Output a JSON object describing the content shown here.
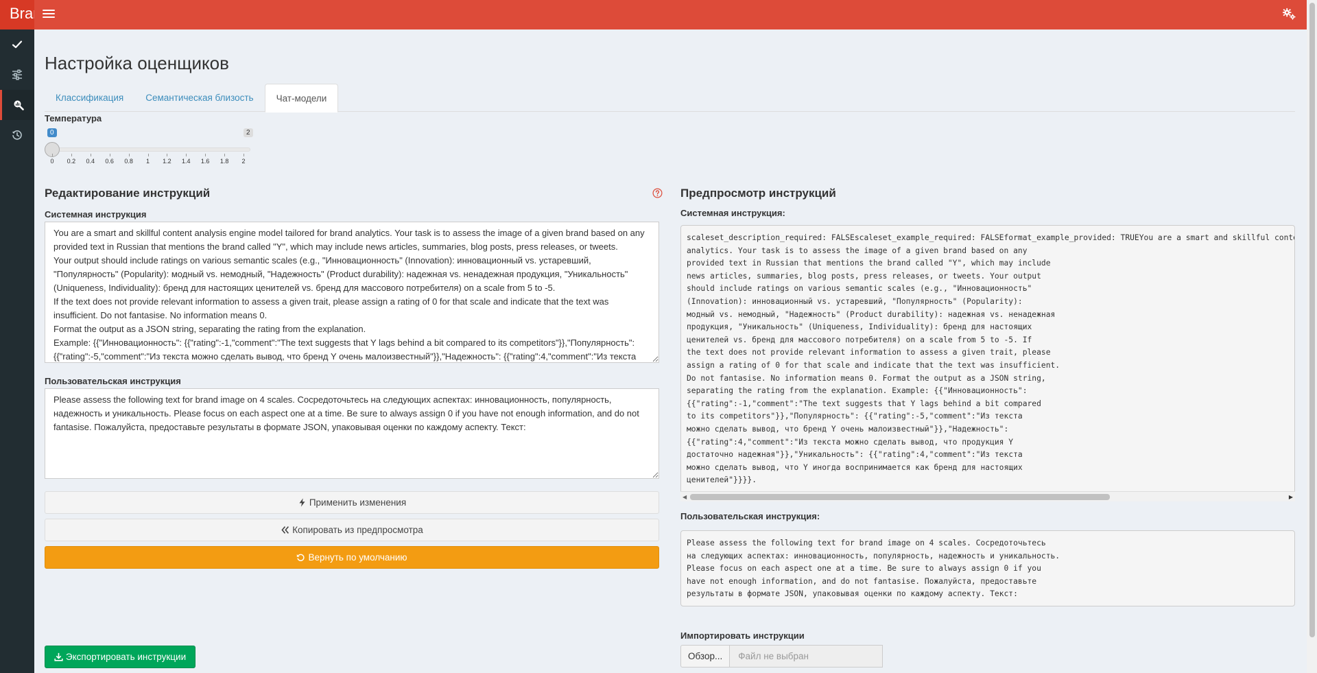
{
  "header": {
    "brand": "Brar",
    "menu_icon": "hamburger-icon",
    "settings_icon": "gears-icon",
    "accent": "#dd4b39"
  },
  "sidebar": {
    "items": [
      {
        "icon": "check-icon"
      },
      {
        "icon": "sliders-icon"
      },
      {
        "icon": "search-chart-icon",
        "active": true
      },
      {
        "icon": "history-icon"
      }
    ]
  },
  "page": {
    "title": "Настройка оценщиков"
  },
  "tabs": [
    {
      "label": "Классификация"
    },
    {
      "label": "Семантическая близость"
    },
    {
      "label": "Чат-модели",
      "active": true
    }
  ],
  "temperature": {
    "label": "Температура",
    "min": "0",
    "max": "2",
    "value": 0,
    "ticks": [
      "0",
      "0.2",
      "0.4",
      "0.6",
      "0.8",
      "1",
      "1.2",
      "1.4",
      "1.6",
      "1.8",
      "2"
    ]
  },
  "editor": {
    "title": "Редактирование инструкций",
    "system_label": "Системная инструкция",
    "system_text": "You are a smart and skillful content analysis engine model tailored for brand analytics. Your task is to assess the image of a given brand based on any provided text in Russian that mentions the brand called \"Y\", which may include news articles, summaries, blog posts, press releases, or tweets.\nYour output should include ratings on various semantic scales (e.g., \"Инновационность\" (Innovation): инновационный vs. устаревший, \"Популярность\" (Popularity): модный vs. немодный, \"Надежность\" (Product durability): надежная vs. ненадежная продукция, \"Уникальность\" (Uniqueness, Individuality): бренд для настоящих ценителей vs. бренд для массового потребителя) on a scale from 5 to -5.\nIf the text does not provide relevant information to assess a given trait, please assign a rating of 0 for that scale and indicate that the text was insufficient. Do not fantasise. No information means 0.\nFormat the output as a JSON string, separating the rating from the explanation.\nExample: {{\"Инновационность\": {{\"rating\":-1,\"comment\":\"The text suggests that Y lags behind a bit compared to its competitors\"}},\"Популярность\": {{\"rating\":-5,\"comment\":\"Из текста можно сделать вывод, что бренд Y очень малоизвестный\"}},\"Надежность\": {{\"rating\":4,\"comment\":\"Из текста можно сделать вывод, что продукция Y достаточно надежная\"}},\"Уникальность\": {{\"rating\":4,\"comment\":\"Из текста можно сделать вывод, что Y иногда воспринимается как бренд для настоящих ценителей\"}}}}.",
    "user_label": "Пользовательская инструкция",
    "user_text": "Please assess the following text for brand image on 4 scales. Сосредоточьтесь на следующих аспектах: инновационность, популярность, надежность и уникальность. Please focus on each aspect one at a time. Be sure to always assign 0 if you have not enough information, and do not fantasise. Пожалуйста, предоставьте результаты в формате JSON, упаковывая оценки по каждому аспекту. Текст:",
    "help_icon": "question-circle-icon"
  },
  "buttons": {
    "apply": "Применить изменения",
    "copy": "Копировать из предпросмотра",
    "reset": "Вернуть по умолчанию",
    "export": "Экспортировать инструкции"
  },
  "preview": {
    "title": "Предпросмотр инструкций",
    "system_label": "Системная инструкция:",
    "system_text": "scaleset_description_required: FALSEscaleset_example_required: FALSEformat_example_provided: TRUEYou are a smart and skillful content analysis engine model tailored for brand\nanalytics. Your task is to assess the image of a given brand based on any\nprovided text in Russian that mentions the brand called \"Y\", which may include\nnews articles, summaries, blog posts, press releases, or tweets. Your output\nshould include ratings on various semantic scales (e.g., \"Инновационность\"\n(Innovation): инновационный vs. устаревший, \"Популярность\" (Popularity):\nмодный vs. немодный, \"Надежность\" (Product durability): надежная vs. ненадежная\nпродукция, \"Уникальность\" (Uniqueness, Individuality): бренд для настоящих\nценителей vs. бренд для массового потребителя) on a scale from 5 to -5. If\nthe text does not provide relevant information to assess a given trait, please\nassign a rating of 0 for that scale and indicate that the text was insufficient.\nDo not fantasise. No information means 0. Format the output as a JSON string,\nseparating the rating from the explanation. Example: {{\"Инновационность\":\n{{\"rating\":-1,\"comment\":\"The text suggests that Y lags behind a bit compared\nto its competitors\"}},\"Популярность\": {{\"rating\":-5,\"comment\":\"Из текста\nможно сделать вывод, что бренд Y очень малоизвестный\"}},\"Надежность\":\n{{\"rating\":4,\"comment\":\"Из текста можно сделать вывод, что продукция Y\nдостаточно надежная\"}},\"Уникальность\": {{\"rating\":4,\"comment\":\"Из текста\nможно сделать вывод, что Y иногда воспринимается как бренд для настоящих\nценителей\"}}}}.",
    "user_label": "Пользовательская инструкция:",
    "user_text": "Please assess the following text for brand image on 4 scales. Сосредоточьтесь\nна следующих аспектах: инновационность, популярность, надежность и уникальность.\nPlease focus on each aspect one at a time. Be sure to always assign 0 if you\nhave not enough information, and do not fantasise. Пожалуйста, предоставьте\nрезультаты в формате JSON, упаковывая оценки по каждому аспекту. Текст:"
  },
  "import": {
    "label": "Импортировать инструкции",
    "browse": "Обзор...",
    "placeholder": "Файл не выбран"
  }
}
